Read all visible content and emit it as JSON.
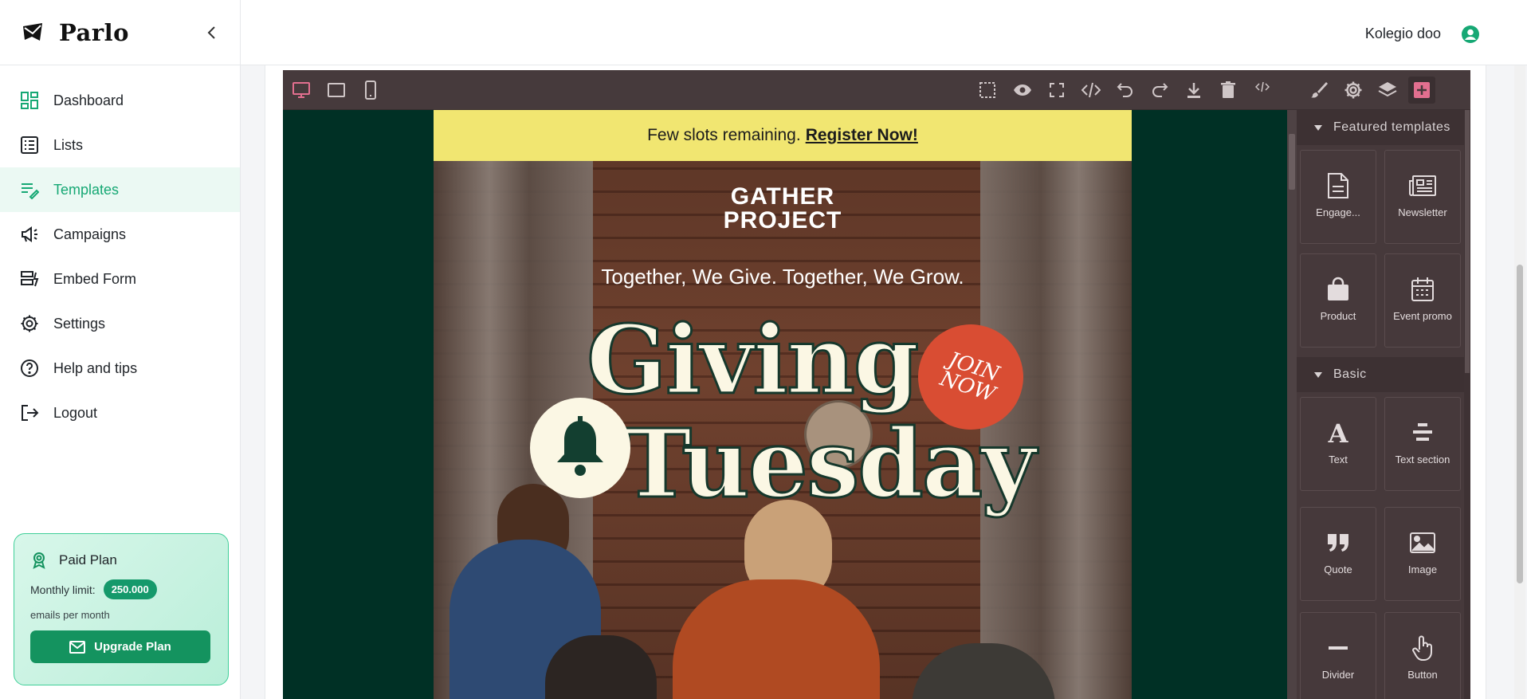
{
  "brand": {
    "name": "Parlo"
  },
  "nav": {
    "items": [
      {
        "label": "Dashboard",
        "icon": "dashboard-icon"
      },
      {
        "label": "Lists",
        "icon": "list-icon"
      },
      {
        "label": "Templates",
        "icon": "templates-icon",
        "active": true
      },
      {
        "label": "Campaigns",
        "icon": "megaphone-icon"
      },
      {
        "label": "Embed Form",
        "icon": "embed-form-icon"
      },
      {
        "label": "Settings",
        "icon": "gear-icon"
      },
      {
        "label": "Help and tips",
        "icon": "help-icon"
      },
      {
        "label": "Logout",
        "icon": "logout-icon"
      }
    ]
  },
  "plan": {
    "title": "Paid Plan",
    "limit_label": "Monthly limit:",
    "limit_value": "250.000",
    "sub": "emails per month",
    "upgrade_label": "Upgrade Plan"
  },
  "header": {
    "user_name": "Kolegio doo"
  },
  "email": {
    "banner_text": "Few slots remaining.",
    "banner_link": "Register Now!",
    "logo_line1": "GATHER",
    "logo_line2": "PROJECT",
    "tagline": "Together, We Give. Together, We Grow.",
    "headline_1": "Giving",
    "headline_2": "Tuesday",
    "badge_line1": "JOIN",
    "badge_line2": "NOW"
  },
  "panel": {
    "featured_title": "Featured templates",
    "basic_title": "Basic",
    "featured": [
      {
        "label": "Engage...",
        "icon": "document-icon"
      },
      {
        "label": "Newsletter",
        "icon": "newspaper-icon"
      },
      {
        "label": "Product",
        "icon": "shopping-bag-icon"
      },
      {
        "label": "Event promo",
        "icon": "calendar-icon"
      }
    ],
    "basic": [
      {
        "label": "Text",
        "icon": "text-icon"
      },
      {
        "label": "Text section",
        "icon": "text-section-icon"
      },
      {
        "label": "Quote",
        "icon": "quote-icon"
      },
      {
        "label": "Image",
        "icon": "image-icon"
      },
      {
        "label": "Divider",
        "icon": "divider-icon"
      },
      {
        "label": "Button",
        "icon": "pointer-hand-icon"
      }
    ]
  },
  "colors": {
    "accent": "#16a874",
    "editor_bg": "#46393b",
    "canvas_bg": "#003025",
    "banner": "#f1e671",
    "join_badge": "#d94d33"
  }
}
